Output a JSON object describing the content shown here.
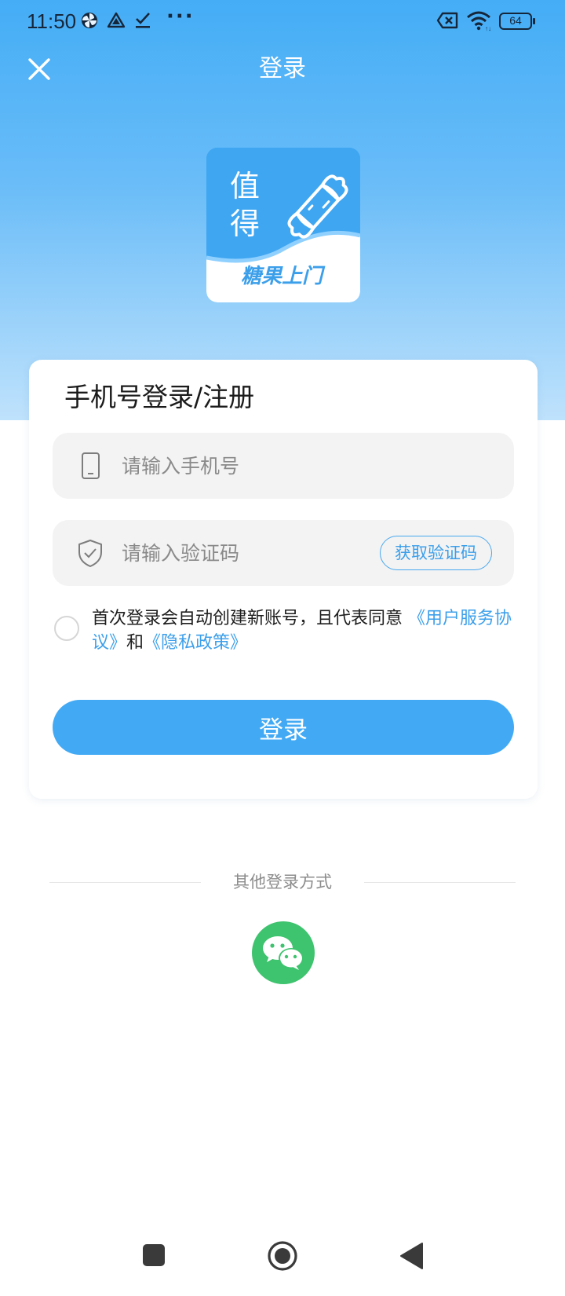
{
  "status_bar": {
    "time": "11:50",
    "battery": "64",
    "icons": [
      "pinwheel-icon",
      "triangle-app-icon",
      "check-download-icon",
      "more-dots-icon",
      "sim-off-icon",
      "wifi-icon",
      "battery-icon"
    ]
  },
  "header": {
    "title": "登录",
    "close_icon": "close-icon"
  },
  "logo": {
    "line1": "值",
    "line2": "得",
    "tagline": "糖果上门",
    "icon": "candy-icon"
  },
  "form": {
    "title": "手机号登录/注册",
    "phone": {
      "placeholder": "请输入手机号",
      "value": "",
      "icon": "phone-icon"
    },
    "code": {
      "placeholder": "请输入验证码",
      "value": "",
      "icon": "shield-check-icon",
      "button_label": "获取验证码"
    },
    "agreement": {
      "text": "首次登录会自动创建新账号，且代表同意",
      "link_terms": "《用户服务协议》",
      "connector": "和",
      "link_privacy": "《隐私政策》"
    },
    "submit_label": "登录"
  },
  "other_login": {
    "label": "其他登录方式",
    "wechat_icon": "wechat-icon"
  },
  "nav_bar": {
    "icons": [
      "recents-square-icon",
      "home-circle-icon",
      "back-triangle-icon"
    ]
  },
  "colors": {
    "accent": "#42aaf5",
    "link": "#3c9fea",
    "wechat": "#3ec36e"
  }
}
